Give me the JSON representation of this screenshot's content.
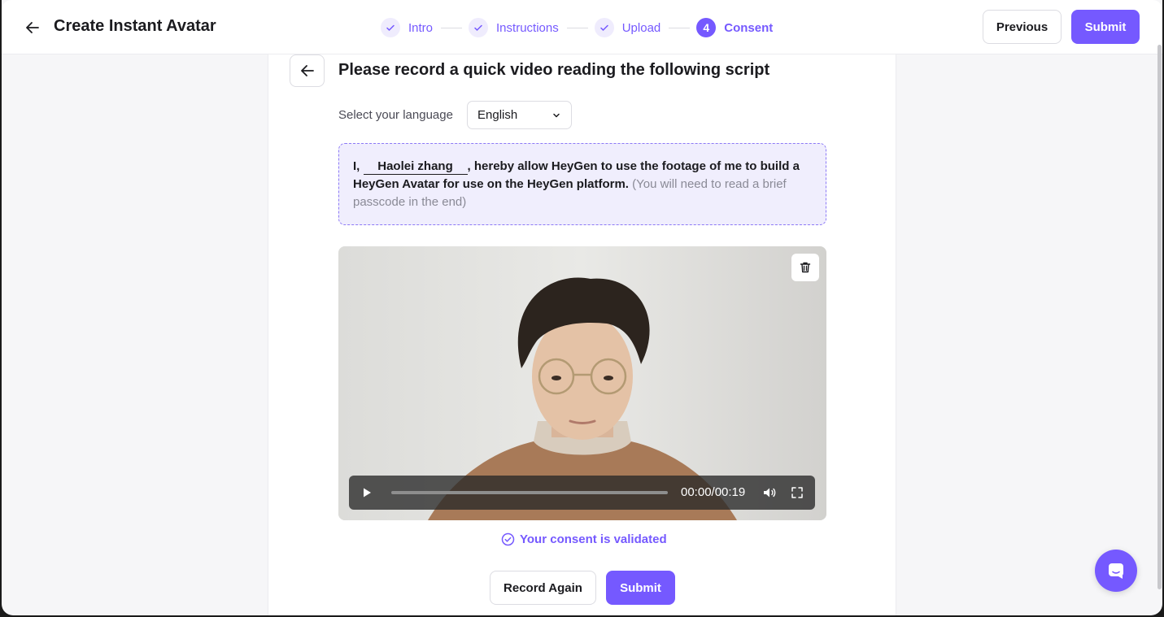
{
  "header": {
    "title": "Create Instant Avatar",
    "steps": [
      {
        "label": "Intro",
        "state": "done"
      },
      {
        "label": "Instructions",
        "state": "done"
      },
      {
        "label": "Upload",
        "state": "done"
      },
      {
        "label": "Consent",
        "state": "active",
        "number": "4"
      }
    ],
    "previous_label": "Previous",
    "submit_label": "Submit"
  },
  "card": {
    "title": "Please record a quick video reading the following script",
    "language_label": "Select your language",
    "language_value": "English",
    "script": {
      "prefix": "I, ",
      "name": "Haolei zhang",
      "statement": ", hereby allow HeyGen to use the footage of me to build a HeyGen Avatar for use on the HeyGen platform.",
      "hint": "(You will need to read a brief passcode in the end)"
    },
    "video": {
      "time": "00:00/00:19",
      "progress": 0
    },
    "validated_text": "Your consent is validated",
    "record_again_label": "Record Again",
    "submit_label": "Submit"
  },
  "colors": {
    "accent": "#7559ff",
    "accent_light": "#f0eefd"
  },
  "icons": [
    "arrow-left-icon",
    "check-icon",
    "chevron-down-icon",
    "trash-icon",
    "play-icon",
    "volume-icon",
    "fullscreen-icon",
    "check-circle-icon",
    "chat-icon"
  ]
}
